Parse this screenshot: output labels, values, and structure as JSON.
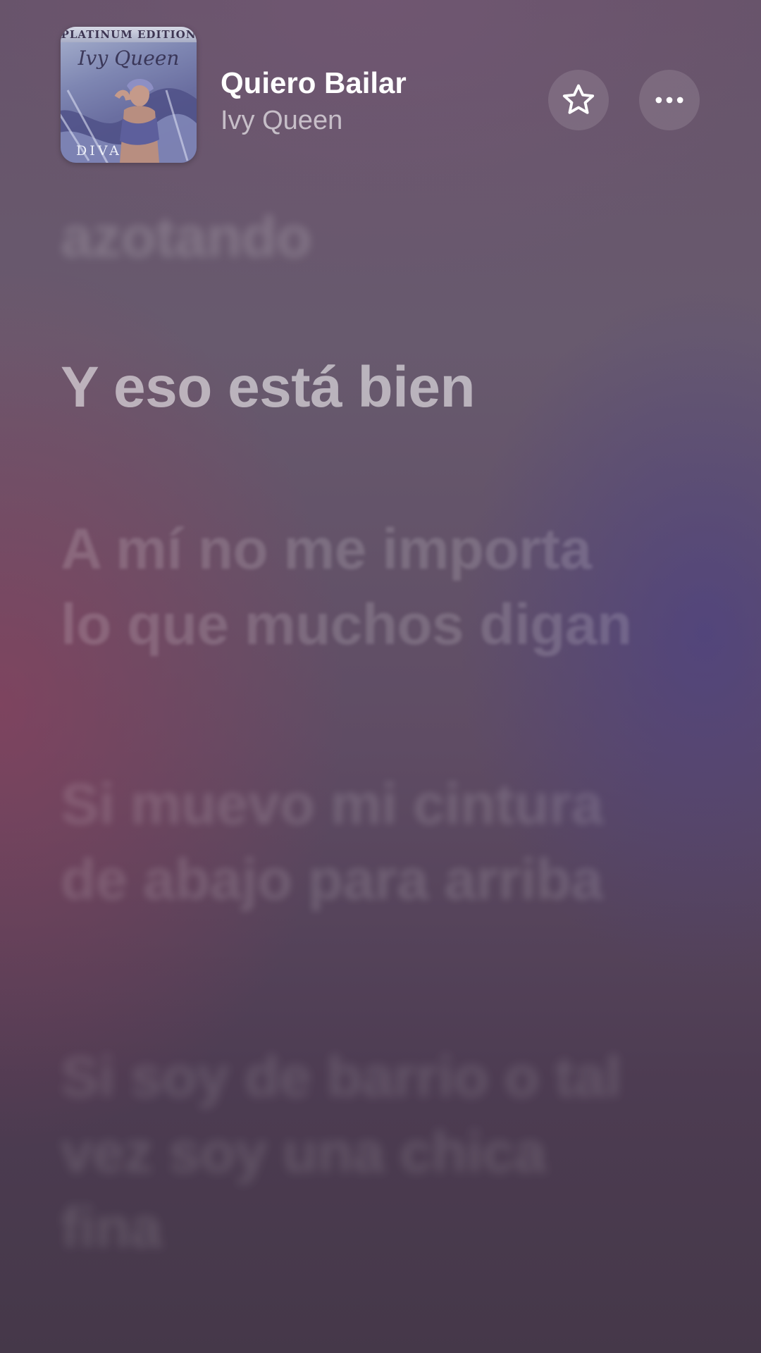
{
  "now_playing": {
    "title": "Quiero Bailar",
    "artist": "Ivy Queen",
    "artwork": {
      "edition_text": "PLATINUM EDITION",
      "logo_text": "Ivy Queen",
      "album_text": "DIVA"
    }
  },
  "actions": {
    "favorite_icon": "star-outline-icon",
    "more_icon": "ellipsis-icon"
  },
  "lyrics": {
    "previous": [
      "azotando"
    ],
    "active": [
      "Y eso está bien"
    ],
    "upcoming": [
      [
        "A mí no me importa",
        "lo que muchos digan"
      ],
      [
        "Si muevo mi cintura",
        "de abajo para arriba"
      ],
      [
        "Si soy de barrio o tal",
        "vez soy una chica",
        "fina"
      ]
    ]
  },
  "colors": {
    "title": "#ffffff",
    "artist": "rgba(255,255,255,0.62)",
    "active_lyric": "rgba(255,255,255,0.55)",
    "button_bg": "rgba(255,255,255,0.12)"
  }
}
